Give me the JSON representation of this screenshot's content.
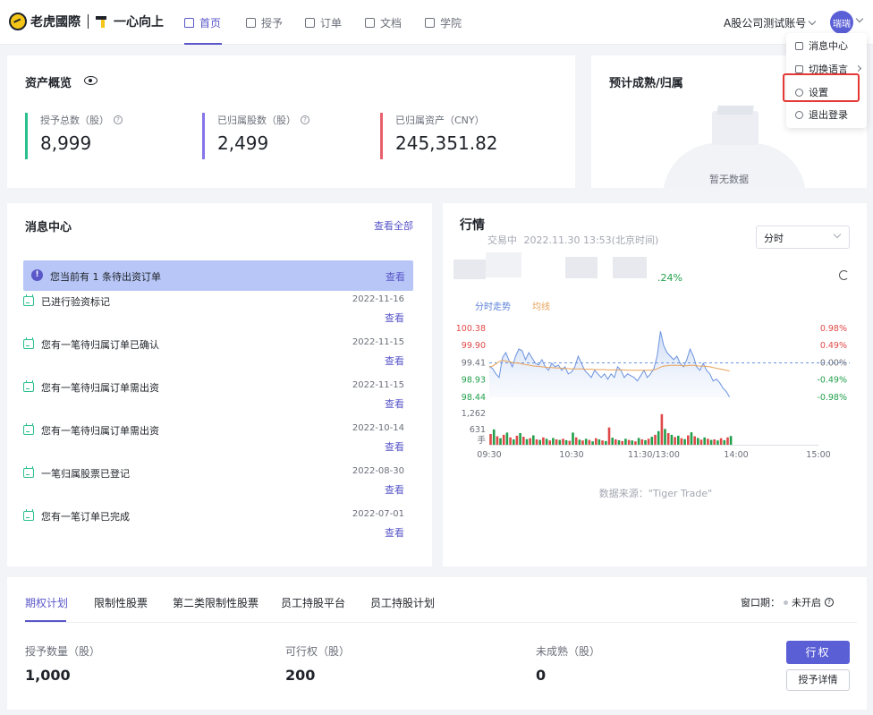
{
  "brand": {
    "name": "老虎國際",
    "slogan": "一心向上"
  },
  "nav": {
    "items": [
      {
        "label": "首页",
        "active": true
      },
      {
        "label": "授予"
      },
      {
        "label": "订单"
      },
      {
        "label": "文档"
      },
      {
        "label": "学院"
      }
    ],
    "account": "A股公司测试账号",
    "avatar": "瑞瑞"
  },
  "user_menu": {
    "items": [
      "消息中心",
      "切换语言",
      "设置",
      "退出登录"
    ]
  },
  "assets": {
    "title": "资产概览",
    "stats": [
      {
        "label": "授予总数（股）",
        "value": "8,999",
        "color": "#2bbf8f"
      },
      {
        "label": "已归属股数（股）",
        "value": "2,499",
        "color": "#8675ea"
      },
      {
        "label": "已归属资产（CNY）",
        "value": "245,351.82",
        "color": "#e8606b"
      }
    ]
  },
  "forecast": {
    "title": "预计成熟/归属",
    "empty": "暂无数据"
  },
  "messages": {
    "title": "消息中心",
    "view_all": "查看全部",
    "alert": {
      "text": "您当前有 1 条待出资订单",
      "action": "查看"
    },
    "view_label": "查看",
    "items": [
      {
        "text": "已进行验资标记",
        "date": "2022-11-16"
      },
      {
        "text": "您有一笔待归属订单已确认",
        "date": "2022-11-15"
      },
      {
        "text": "您有一笔待归属订单需出资",
        "date": "2022-11-15"
      },
      {
        "text": "您有一笔待归属订单需出资",
        "date": "2022-10-14"
      },
      {
        "text": "一笔归属股票已登记",
        "date": "2022-08-30"
      },
      {
        "text": "您有一笔订单已完成",
        "date": "2022-07-01"
      }
    ]
  },
  "market": {
    "title": "行情",
    "status": "交易中",
    "time": "2022.11.30 13:53(北京时间)",
    "period": "分时",
    "change_pct": ".24%",
    "legend_trend": "分时走势",
    "legend_avg": "均线",
    "source": "数据来源：\"Tiger Trade\""
  },
  "chart_data": {
    "type": "line",
    "series": [
      {
        "name": "分时走势",
        "color": "#6b93de"
      },
      {
        "name": "均线",
        "color": "#e8a25a"
      }
    ],
    "x_ticks": [
      "09:30",
      "10:30",
      "11:30/13:00",
      "14:00",
      "15:00"
    ],
    "y_ticks": [
      "100.38",
      "99.90",
      "99.41",
      "98.93",
      "98.44"
    ],
    "y_pct_ticks": [
      "0.98%",
      "0.49%",
      "0.00%",
      "-0.49%",
      "-0.98%"
    ],
    "ylim": [
      98.44,
      100.38
    ],
    "prev_close": 99.41,
    "price": [
      99.32,
      99.25,
      99.1,
      99.0,
      99.55,
      99.7,
      99.48,
      99.3,
      99.6,
      99.8,
      99.75,
      99.5,
      99.7,
      99.55,
      99.4,
      99.35,
      99.5,
      99.3,
      99.2,
      99.4,
      99.3,
      99.35,
      99.2,
      99.3,
      99.1,
      99.15,
      99.3,
      99.6,
      99.4,
      99.2,
      99.1,
      99.0,
      99.2,
      99.1,
      99.0,
      99.1,
      98.95,
      99.1,
      99.0,
      99.3,
      99.2,
      99.0,
      99.1,
      99.05,
      99.0,
      98.9,
      99.05,
      99.2,
      99.0,
      99.1,
      99.25,
      99.6,
      100.3,
      99.9,
      99.7,
      99.6,
      99.5,
      99.6,
      99.4,
      99.3,
      99.5,
      99.8,
      99.6,
      99.3,
      99.2,
      99.4,
      99.2,
      99.1,
      98.9,
      98.95,
      98.85,
      98.7,
      98.6,
      98.45
    ],
    "avg": [
      99.3,
      99.32,
      99.38,
      99.45,
      99.48,
      99.46,
      99.44,
      99.42,
      99.41,
      99.4,
      99.38,
      99.36,
      99.35,
      99.33,
      99.32,
      99.31,
      99.3,
      99.29,
      99.28,
      99.28,
      99.27,
      99.27,
      99.26,
      99.25,
      99.25,
      99.24,
      99.24,
      99.24,
      99.24,
      99.23,
      99.23,
      99.23,
      99.22,
      99.22,
      99.22,
      99.22,
      99.21,
      99.21,
      99.21,
      99.21,
      99.21,
      99.21,
      99.2,
      99.2,
      99.2,
      99.2,
      99.2,
      99.2,
      99.2,
      99.2,
      99.21,
      99.24,
      99.29,
      99.32,
      99.33,
      99.34,
      99.34,
      99.34,
      99.34,
      99.33,
      99.33,
      99.34,
      99.34,
      99.33,
      99.32,
      99.32,
      99.31,
      99.3,
      99.28,
      99.26,
      99.24,
      99.22,
      99.2,
      99.18
    ],
    "volume_ticks": [
      "1,262",
      "631",
      "手"
    ],
    "volume_max": 1262,
    "volume": [
      380,
      540,
      300,
      230,
      350,
      430,
      260,
      190,
      320,
      410,
      280,
      200,
      230,
      330,
      190,
      170,
      260,
      210,
      150,
      240,
      190,
      170,
      210,
      160,
      140,
      430,
      260,
      180,
      150,
      210,
      170,
      120,
      230,
      190,
      150,
      130,
      610,
      250,
      190,
      160,
      130,
      210,
      170,
      150,
      120,
      240,
      190,
      160,
      210,
      280,
      350,
      480,
      1080,
      560,
      410,
      350,
      270,
      320,
      230,
      200,
      330,
      440,
      300,
      240,
      180,
      260,
      210,
      170,
      190,
      150,
      230,
      160,
      260,
      310
    ],
    "volume_colors": [
      "#e04848",
      "#22a04c"
    ]
  },
  "plans": {
    "tabs": [
      "期权计划",
      "限制性股票",
      "第二类限制性股票",
      "员工持股平台",
      "员工持股计划"
    ],
    "window_label": "窗口期：",
    "window_status": "未开启",
    "fields": [
      {
        "label": "授予数量（股）",
        "value": "1,000"
      },
      {
        "label": "可行权（股）",
        "value": "200"
      },
      {
        "label": "未成熟（股）",
        "value": "0"
      }
    ],
    "exercise_button": "行权",
    "detail_button": "授予详情"
  }
}
